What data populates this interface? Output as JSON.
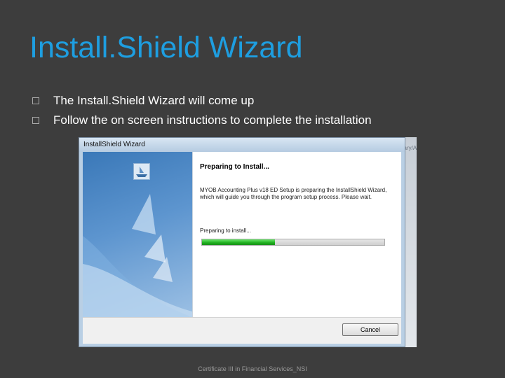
{
  "slide": {
    "title": "Install.Shield Wizard",
    "bullets": [
      "The Install.Shield Wizard will come up",
      "Follow the on screen instructions to complete the installation"
    ],
    "footer": "Certificate III in Financial Services_NSI"
  },
  "screenshot": {
    "background_menu_text": "Ⓥ/Library/Ad...",
    "window": {
      "title": "InstallShield Wizard",
      "heading": "Preparing to Install...",
      "description": "MYOB Accounting Plus v18 ED Setup is preparing the InstallShield Wizard, which will guide you through the program setup process. Please wait.",
      "status": "Preparing to install...",
      "progress": 0.4,
      "cancel_label": "Cancel"
    }
  },
  "colors": {
    "title": "#1e9ee0",
    "background": "#3d3d3d",
    "progress": "#1fae1f"
  }
}
